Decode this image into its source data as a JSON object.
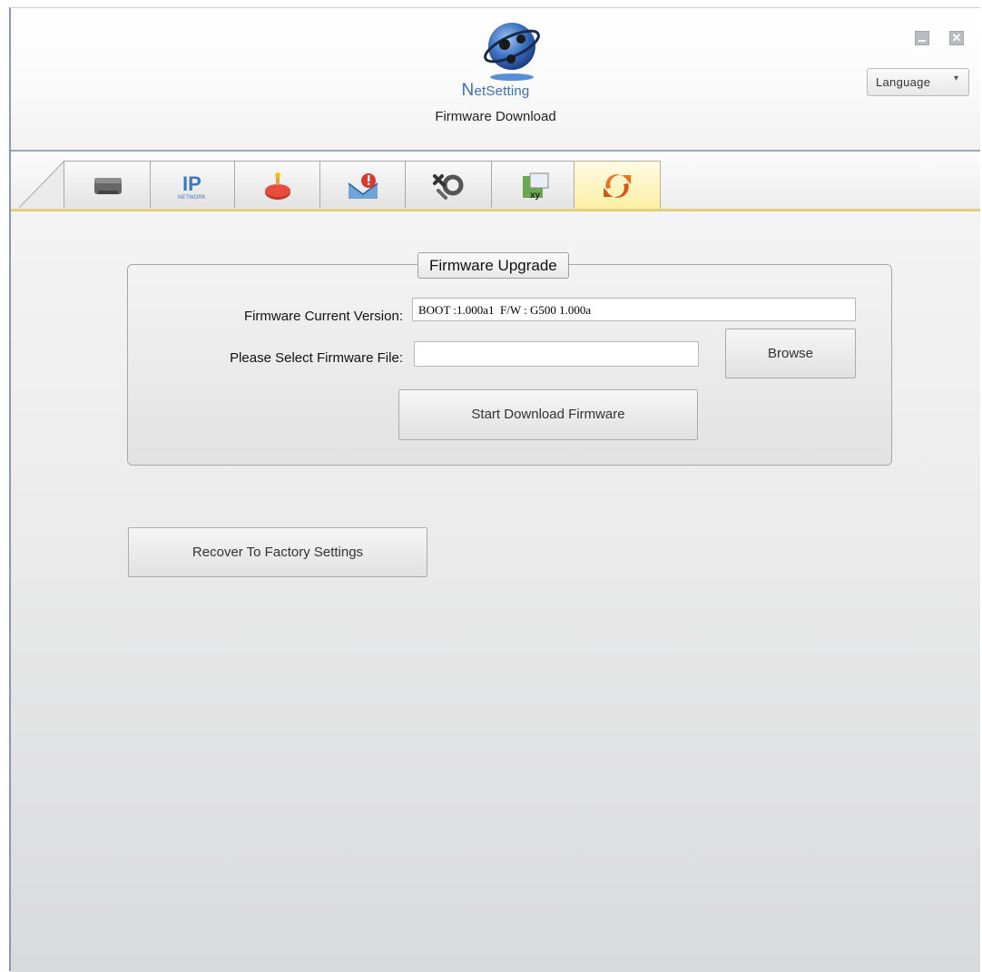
{
  "header": {
    "logo_initial": "N",
    "logo_rest": "etSetting",
    "subtitle": "Firmware Download",
    "language_label": "Language",
    "language_arrow": "▾",
    "close_glyph": "✕"
  },
  "tabs": [
    {
      "name": "printer-tab",
      "icon": "printer-icon"
    },
    {
      "name": "ip-network-tab",
      "icon": "ip-network-icon",
      "label": "NETWORK",
      "big": "IP"
    },
    {
      "name": "alarm-tab",
      "icon": "alarm-light-icon"
    },
    {
      "name": "email-alert-tab",
      "icon": "email-alert-icon"
    },
    {
      "name": "tools-tab",
      "icon": "tools-icon"
    },
    {
      "name": "config-tab",
      "icon": "config-xy-icon",
      "label": "xy"
    },
    {
      "name": "firmware-tab",
      "icon": "refresh-icon",
      "active": true
    }
  ],
  "firmware_upgrade": {
    "title": "Firmware Upgrade",
    "current_version_label": "Firmware Current Version:",
    "current_version_value": "BOOT :1.000a1  F/W : G500 1.000a",
    "select_file_label": "Please Select Firmware File:",
    "select_file_value": "",
    "browse_label": "Browse",
    "start_label": "Start Download Firmware"
  },
  "recover_label": "Recover To Factory  Settings"
}
